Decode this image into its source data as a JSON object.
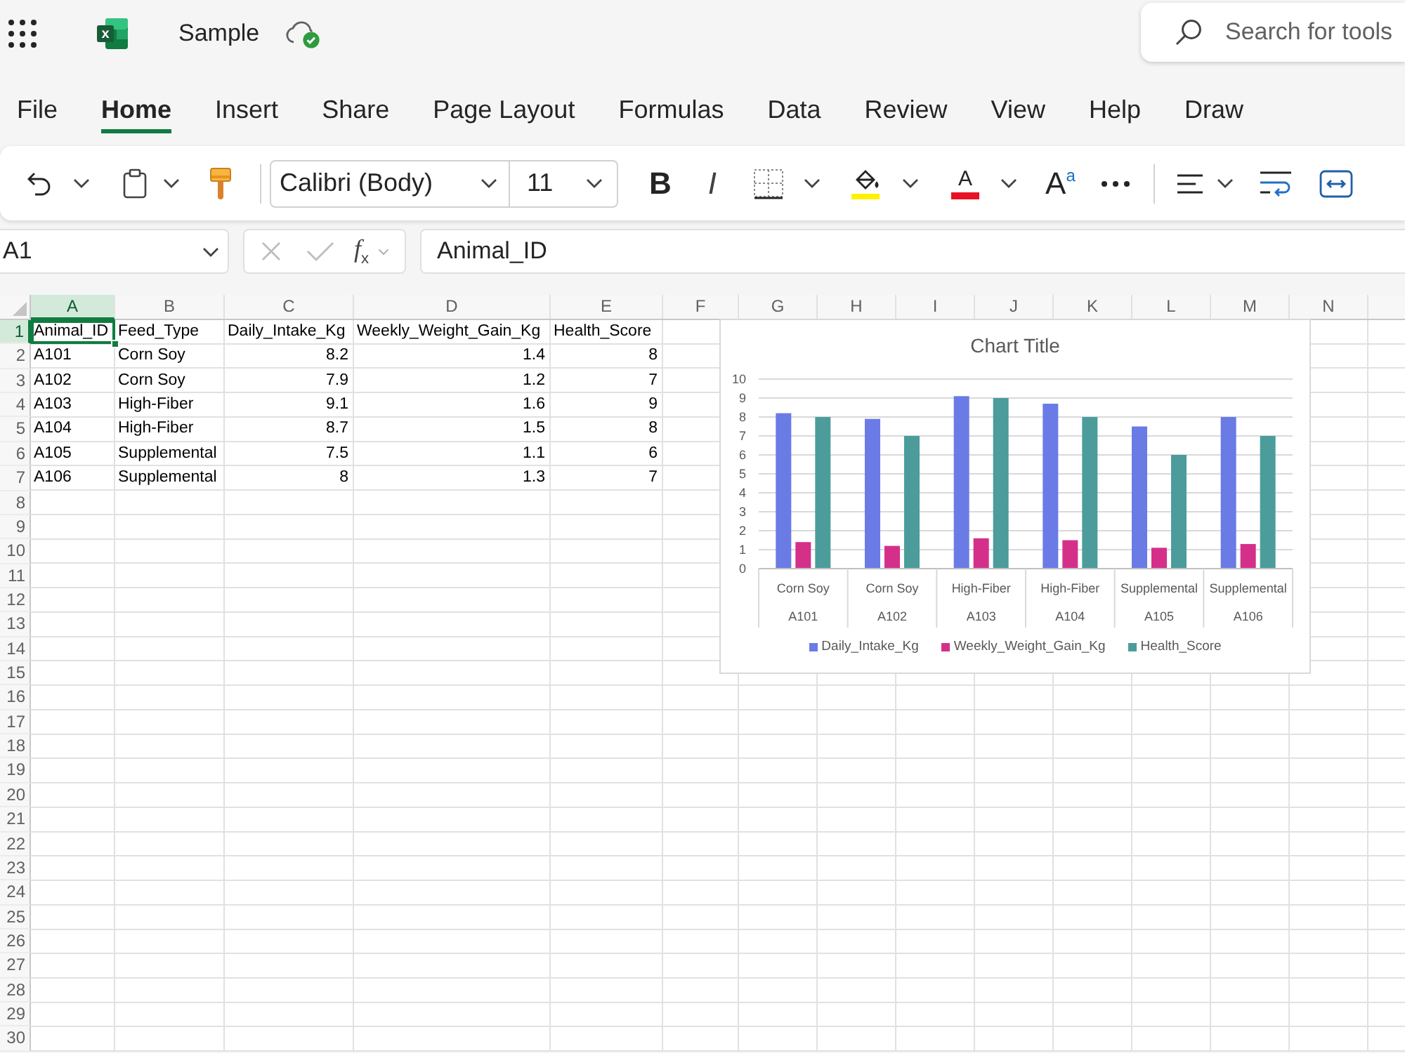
{
  "top_bar": {
    "logo_letter": "x",
    "document_title": "Sample",
    "saved": true,
    "search": {
      "placeholder": "Search for tools"
    }
  },
  "ribbon_tabs": [
    {
      "label": "File",
      "selected": false
    },
    {
      "label": "Home",
      "selected": true
    },
    {
      "label": "Insert",
      "selected": false
    },
    {
      "label": "Share",
      "selected": false
    },
    {
      "label": "Page Layout",
      "selected": false
    },
    {
      "label": "Formulas",
      "selected": false
    },
    {
      "label": "Data",
      "selected": false
    },
    {
      "label": "Review",
      "selected": false
    },
    {
      "label": "View",
      "selected": false
    },
    {
      "label": "Help",
      "selected": false
    },
    {
      "label": "Draw",
      "selected": false
    }
  ],
  "toolbar": {
    "font_name": "Calibri (Body)",
    "font_size": "11",
    "bold_label": "B",
    "italic_label": "I",
    "font_color_label": "A",
    "grow_font_label": "A$^{a}$"
  },
  "formula_bar": {
    "name_box": "A1",
    "function_label": "f$_{x}$",
    "formula": "Animal_ID"
  },
  "sheet": {
    "columns": [
      {
        "label": "A",
        "selected": true
      },
      {
        "label": "B",
        "selected": false
      },
      {
        "label": "C",
        "selected": false
      },
      {
        "label": "D",
        "selected": false
      },
      {
        "label": "E",
        "selected": false
      },
      {
        "label": "F",
        "selected": false
      },
      {
        "label": "G",
        "selected": false
      },
      {
        "label": "H",
        "selected": false
      },
      {
        "label": "I",
        "selected": false
      },
      {
        "label": "J",
        "selected": false
      },
      {
        "label": "K",
        "selected": false
      },
      {
        "label": "L",
        "selected": false
      },
      {
        "label": "M",
        "selected": false
      },
      {
        "label": "N",
        "selected": false
      }
    ],
    "rows": [
      {
        "label": "1",
        "selected": true,
        "cells": [
          {
            "text": "Animal_ID",
            "kind": "text",
            "selected": true
          },
          {
            "text": "Feed_Type",
            "kind": "text",
            "selected": false
          },
          {
            "text": "Daily_Intake_Kg",
            "kind": "text",
            "selected": false
          },
          {
            "text": "Weekly_Weight_Gain_Kg",
            "kind": "text",
            "selected": false
          },
          {
            "text": "Health_Score",
            "kind": "text",
            "selected": false
          }
        ]
      },
      {
        "label": "2",
        "selected": false,
        "cells": [
          {
            "text": "A101",
            "kind": "text",
            "selected": false
          },
          {
            "text": "Corn Soy",
            "kind": "text",
            "selected": false
          },
          {
            "text": "8.2",
            "kind": "number",
            "selected": false
          },
          {
            "text": "1.4",
            "kind": "number",
            "selected": false
          },
          {
            "text": "8",
            "kind": "number",
            "selected": false
          }
        ]
      },
      {
        "label": "3",
        "selected": false,
        "cells": [
          {
            "text": "A102",
            "kind": "text",
            "selected": false
          },
          {
            "text": "Corn Soy",
            "kind": "text",
            "selected": false
          },
          {
            "text": "7.9",
            "kind": "number",
            "selected": false
          },
          {
            "text": "1.2",
            "kind": "number",
            "selected": false
          },
          {
            "text": "7",
            "kind": "number",
            "selected": false
          }
        ]
      },
      {
        "label": "4",
        "selected": false,
        "cells": [
          {
            "text": "A103",
            "kind": "text",
            "selected": false
          },
          {
            "text": "High-Fiber",
            "kind": "text",
            "selected": false
          },
          {
            "text": "9.1",
            "kind": "number",
            "selected": false
          },
          {
            "text": "1.6",
            "kind": "number",
            "selected": false
          },
          {
            "text": "9",
            "kind": "number",
            "selected": false
          }
        ]
      },
      {
        "label": "5",
        "selected": false,
        "cells": [
          {
            "text": "A104",
            "kind": "text",
            "selected": false
          },
          {
            "text": "High-Fiber",
            "kind": "text",
            "selected": false
          },
          {
            "text": "8.7",
            "kind": "number",
            "selected": false
          },
          {
            "text": "1.5",
            "kind": "number",
            "selected": false
          },
          {
            "text": "8",
            "kind": "number",
            "selected": false
          }
        ]
      },
      {
        "label": "6",
        "selected": false,
        "cells": [
          {
            "text": "A105",
            "kind": "text",
            "selected": false
          },
          {
            "text": "Supplemental",
            "kind": "text",
            "selected": false
          },
          {
            "text": "7.5",
            "kind": "number",
            "selected": false
          },
          {
            "text": "1.1",
            "kind": "number",
            "selected": false
          },
          {
            "text": "6",
            "kind": "number",
            "selected": false
          }
        ]
      },
      {
        "label": "7",
        "selected": false,
        "cells": [
          {
            "text": "A106",
            "kind": "text",
            "selected": false
          },
          {
            "text": "Supplemental",
            "kind": "text",
            "selected": false
          },
          {
            "text": "8",
            "kind": "number",
            "selected": false
          },
          {
            "text": "1.3",
            "kind": "number",
            "selected": false
          },
          {
            "text": "7",
            "kind": "number",
            "selected": false
          }
        ]
      },
      {
        "label": "8",
        "selected": false
      },
      {
        "label": "9",
        "selected": false
      },
      {
        "label": "10",
        "selected": false
      },
      {
        "label": "11",
        "selected": false
      },
      {
        "label": "12",
        "selected": false
      },
      {
        "label": "13",
        "selected": false
      },
      {
        "label": "14",
        "selected": false
      },
      {
        "label": "15",
        "selected": false
      },
      {
        "label": "16",
        "selected": false
      },
      {
        "label": "17",
        "selected": false
      },
      {
        "label": "18",
        "selected": false
      },
      {
        "label": "19",
        "selected": false
      },
      {
        "label": "20",
        "selected": false
      },
      {
        "label": "21",
        "selected": false
      },
      {
        "label": "22",
        "selected": false
      },
      {
        "label": "23",
        "selected": false
      },
      {
        "label": "24",
        "selected": false
      },
      {
        "label": "25",
        "selected": false
      },
      {
        "label": "26",
        "selected": false
      },
      {
        "label": "27",
        "selected": false
      },
      {
        "label": "28",
        "selected": false
      },
      {
        "label": "29",
        "selected": false
      },
      {
        "label": "30",
        "selected": false
      }
    ],
    "chart": {
      "outer_category_labels": [
        "A101",
        "A102",
        "A103",
        "A104",
        "A105",
        "A106"
      ],
      "chart_data": {
        "type": "bar",
        "title": "Chart Title",
        "categories": [
          "Corn Soy",
          "Corn Soy",
          "High-Fiber",
          "High-Fiber",
          "Supplemental",
          "Supplemental"
        ],
        "series": [
          {
            "name": "Daily_Intake_Kg",
            "color": "#6a7be6",
            "values": [
              8.2,
              7.9,
              9.1,
              8.7,
              7.5,
              8
            ]
          },
          {
            "name": "Weekly_Weight_Gain_Kg",
            "color": "#d4308a",
            "values": [
              1.4,
              1.2,
              1.6,
              1.5,
              1.1,
              1.3
            ]
          },
          {
            "name": "Health_Score",
            "color": "#4c9c9c",
            "values": [
              8,
              7,
              9,
              8,
              6,
              7
            ]
          }
        ],
        "ylim": [
          0,
          10
        ],
        "yticks": [
          0,
          1,
          2,
          3,
          4,
          5,
          6,
          7,
          8,
          9,
          10
        ],
        "grid": true,
        "legend": "bottom"
      }
    }
  }
}
